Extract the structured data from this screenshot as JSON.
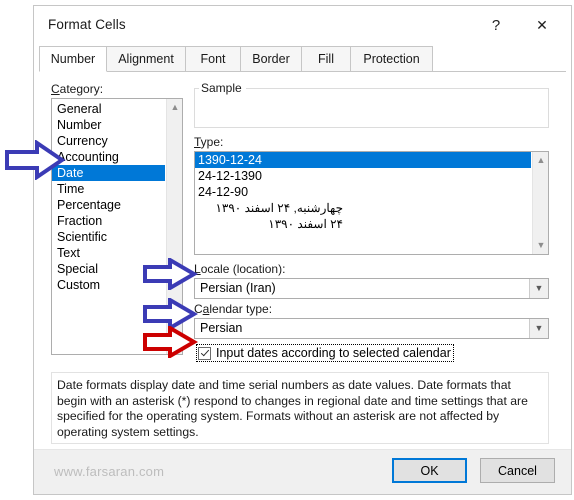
{
  "window": {
    "title": "Format Cells",
    "help_icon": "question-mark-icon",
    "close_icon": "close-x-icon"
  },
  "tabs": [
    {
      "label": "Number",
      "active": true
    },
    {
      "label": "Alignment",
      "active": false
    },
    {
      "label": "Font",
      "active": false
    },
    {
      "label": "Border",
      "active": false
    },
    {
      "label": "Fill",
      "active": false
    },
    {
      "label": "Protection",
      "active": false
    }
  ],
  "category": {
    "label": "Category:",
    "accelerator": "C",
    "items": [
      "General",
      "Number",
      "Currency",
      "Accounting",
      "Date",
      "Time",
      "Percentage",
      "Fraction",
      "Scientific",
      "Text",
      "Special",
      "Custom"
    ],
    "selected": "Date",
    "scroll_up_icon": "chevron-up-icon"
  },
  "sample": {
    "legend": "Sample",
    "value": ""
  },
  "type": {
    "label": "Type:",
    "accelerator": "T",
    "items": [
      {
        "text": "1390-12-24",
        "rtl": false
      },
      {
        "text": "24-12-1390",
        "rtl": false
      },
      {
        "text": "24-12-90",
        "rtl": false
      },
      {
        "text": "چهارشنبه, ۲۴ اسفند ۱۳۹۰",
        "rtl": true
      },
      {
        "text": "۲۴ اسفند ۱۳۹۰",
        "rtl": true
      }
    ],
    "selected_index": 0,
    "scroll_up_icon": "chevron-up-icon",
    "scroll_down_icon": "chevron-down-icon"
  },
  "locale": {
    "label": "Locale (location):",
    "accelerator": "L",
    "value": "Persian (Iran)",
    "dropdown_icon": "chevron-down-icon"
  },
  "calendar": {
    "label": "Calendar type:",
    "accelerator": "a",
    "value": "Persian",
    "dropdown_icon": "chevron-down-icon"
  },
  "input_dates_checkbox": {
    "label": "Input dates according to selected calendar",
    "checked": true,
    "focused": true
  },
  "description": "Date formats display date and time serial numbers as date values.  Date formats that begin with an asterisk (*) respond to changes in regional date and time settings that are specified for the operating system. Formats without an asterisk are not affected by operating system settings.",
  "footer": {
    "watermark": "www.farsaran.com",
    "ok_label": "OK",
    "cancel_label": "Cancel"
  },
  "annotations": [
    {
      "name": "arrow-pointing-to-date-category",
      "color": "#3b3bb5",
      "target": "Date"
    },
    {
      "name": "arrow-pointing-to-locale-combo",
      "color": "#3b3bb5",
      "target": "Locale (location)"
    },
    {
      "name": "arrow-pointing-to-calendar-combo",
      "color": "#3b3bb5",
      "target": "Calendar type"
    },
    {
      "name": "arrow-pointing-to-input-dates-checkbox",
      "color": "#cc0000",
      "target": "Input dates according to selected calendar"
    }
  ],
  "colors": {
    "selection_blue": "#0078d7",
    "annotation_blue": "#3b3bb5",
    "annotation_red": "#cc0000",
    "dialog_background": "#ffffff",
    "footer_background": "#f0f0f0"
  }
}
